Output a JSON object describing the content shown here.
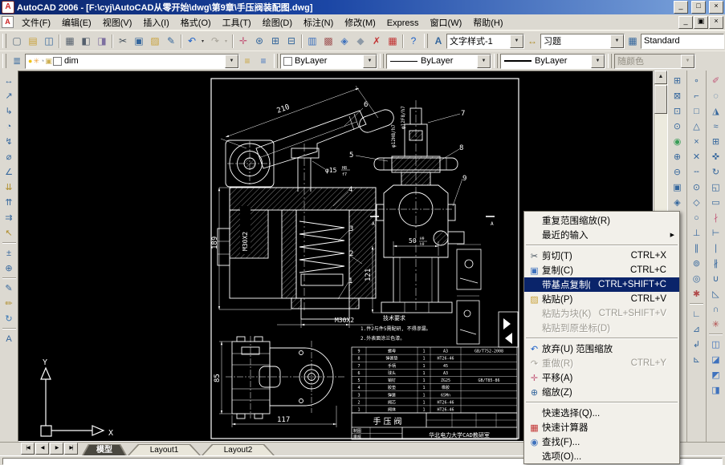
{
  "window": {
    "title": "AutoCAD 2006 - [F:\\cyj\\AutoCAD从零开始\\dwg\\第9章\\手压阀装配图.dwg]",
    "app_icon_letter": "A",
    "buttons": {
      "minimize": "_",
      "maximize": "□",
      "close": "×"
    },
    "child_buttons": {
      "minimize": "_",
      "restore": "▣",
      "close": "×"
    }
  },
  "menu_bar": {
    "items": [
      "文件(F)",
      "编辑(E)",
      "视图(V)",
      "插入(I)",
      "格式(O)",
      "工具(T)",
      "绘图(D)",
      "标注(N)",
      "修改(M)",
      "Express",
      "窗口(W)",
      "帮助(H)"
    ]
  },
  "standard_toolbar": {
    "buttons": [
      {
        "name": "new-button",
        "glyph": "▢",
        "color": "#556a7d"
      },
      {
        "name": "open-button",
        "glyph": "▤",
        "color": "#c9a23a"
      },
      {
        "name": "save-button",
        "glyph": "◫",
        "color": "#35679d"
      },
      {
        "sep": true
      },
      {
        "name": "plot-button",
        "glyph": "▦",
        "color": "#55606d"
      },
      {
        "name": "plot-preview-button",
        "glyph": "◧",
        "color": "#55606d"
      },
      {
        "name": "publish-button",
        "glyph": "◨",
        "color": "#7d6fa0"
      },
      {
        "sep": true
      },
      {
        "name": "cut-button",
        "glyph": "✂",
        "color": "#44505c"
      },
      {
        "name": "copy-button",
        "glyph": "▣",
        "color": "#35679d"
      },
      {
        "name": "paste-button",
        "glyph": "▨",
        "color": "#c9a23a"
      },
      {
        "name": "match-properties-button",
        "glyph": "✎",
        "color": "#35679d"
      },
      {
        "sep": true
      },
      {
        "name": "undo-button",
        "glyph": "↶",
        "color": "#1a5fc8",
        "caret": true
      },
      {
        "name": "redo-button",
        "glyph": "↷",
        "color": "#a8a49a",
        "caret": true,
        "disabled": true
      },
      {
        "sep": true
      },
      {
        "name": "pan-realtime-button",
        "glyph": "✛",
        "color": "#c25a7a"
      },
      {
        "name": "zoom-realtime-button",
        "glyph": "⊛",
        "color": "#35679d"
      },
      {
        "name": "zoom-window-button",
        "glyph": "⊞",
        "color": "#35679d"
      },
      {
        "name": "zoom-previous-button",
        "glyph": "⊟",
        "color": "#35679d"
      },
      {
        "sep": true
      },
      {
        "name": "sheet-set-manager-button",
        "glyph": "▥",
        "color": "#3f72bd"
      },
      {
        "name": "markup-set-manager-button",
        "glyph": "▩",
        "color": "#a05555"
      },
      {
        "name": "hyperlink-button",
        "glyph": "◈",
        "color": "#3f72bd"
      },
      {
        "name": "etransmit-button",
        "glyph": "◆",
        "color": "#8d99a6"
      },
      {
        "name": "tray-cancel-button",
        "glyph": "✗",
        "color": "#c23333"
      },
      {
        "name": "quick-calc-button",
        "glyph": "▦",
        "color": "#c23333"
      },
      {
        "sep": true
      },
      {
        "name": "help-button",
        "glyph": "?",
        "color": "#1a5fc8"
      }
    ]
  },
  "styles_toolbar": {
    "text_style_value": "文字样式-1",
    "dim_style_value": "习题",
    "table_style_value": "Standard",
    "dropdown_glyph": "▼"
  },
  "layers_toolbar": {
    "layer_name": "dim",
    "mini_icons": [
      {
        "name": "bulb-icon",
        "glyph": "●",
        "color": "#f0c418"
      },
      {
        "name": "sun-icon",
        "glyph": "✳",
        "color": "#eda23c"
      },
      {
        "name": "plot-state-icon",
        "glyph": "◔",
        "color": "#9aa4ae"
      },
      {
        "name": "lock-icon",
        "glyph": "▣",
        "color": "#cdb054"
      }
    ]
  },
  "properties_toolbar": {
    "color_value": "ByLayer",
    "linetype_value": "ByLayer",
    "lineweight_value": "ByLayer",
    "plot_style_value": "随颜色"
  },
  "dim_toolbar": {
    "buttons": [
      {
        "name": "dim-linear-button",
        "glyph": "↔",
        "color": "#35679d"
      },
      {
        "name": "dim-aligned-button",
        "glyph": "↗",
        "color": "#35679d"
      },
      {
        "name": "dim-ordinate-button",
        "glyph": "↳",
        "color": "#35679d"
      },
      {
        "name": "dim-radius-button",
        "glyph": "◔",
        "color": "#35679d"
      },
      {
        "name": "dim-jogged-button",
        "glyph": "↯",
        "color": "#35679d"
      },
      {
        "name": "dim-diameter-button",
        "glyph": "⌀",
        "color": "#35679d"
      },
      {
        "name": "dim-angular-button",
        "glyph": "∠",
        "color": "#35679d"
      },
      {
        "name": "quick-dimension-button",
        "glyph": "⇊",
        "color": "#b08f2e"
      },
      {
        "name": "dim-baseline-button",
        "glyph": "⇈",
        "color": "#35679d"
      },
      {
        "name": "dim-continue-button",
        "glyph": "⇉",
        "color": "#35679d"
      },
      {
        "name": "quick-leader-button",
        "glyph": "↖",
        "color": "#b08f2e"
      },
      {
        "sep": true
      },
      {
        "name": "tolerance-button",
        "glyph": "±",
        "color": "#35679d"
      },
      {
        "name": "center-mark-button",
        "glyph": "⊕",
        "color": "#35679d"
      },
      {
        "sep": true
      },
      {
        "name": "dim-edit-button",
        "glyph": "✎",
        "color": "#35679d"
      },
      {
        "name": "dim-text-edit-button",
        "glyph": "✏",
        "color": "#b08f2e"
      },
      {
        "name": "dim-update-button",
        "glyph": "↻",
        "color": "#3a78b5"
      },
      {
        "sep": true
      },
      {
        "name": "dim-style-button",
        "glyph": "A",
        "color": "#35679d"
      }
    ]
  },
  "zoom_toolbar": {
    "buttons": [
      {
        "name": "zoom-window-tool",
        "glyph": "⊞",
        "color": "#35679d"
      },
      {
        "name": "zoom-dynamic-tool",
        "glyph": "⊠",
        "color": "#35679d"
      },
      {
        "name": "zoom-scale-tool",
        "glyph": "⊡",
        "color": "#35679d"
      },
      {
        "name": "zoom-center-tool",
        "glyph": "⊙",
        "color": "#35679d"
      },
      {
        "name": "zoom-object-tool",
        "glyph": "◉",
        "color": "#3a9d58"
      },
      {
        "name": "zoom-in-tool",
        "glyph": "⊕",
        "color": "#35679d"
      },
      {
        "name": "zoom-out-tool",
        "glyph": "⊖",
        "color": "#35679d"
      },
      {
        "name": "zoom-all-tool",
        "glyph": "▣",
        "color": "#35679d"
      },
      {
        "name": "zoom-extents-tool",
        "glyph": "◈",
        "color": "#35679d"
      }
    ]
  },
  "osnap_toolbar": {
    "buttons": [
      {
        "name": "temp-track-point",
        "glyph": "∘",
        "color": "#35679d"
      },
      {
        "name": "snap-from",
        "glyph": "⌐",
        "color": "#35679d"
      },
      {
        "name": "snap-endpoint",
        "glyph": "□",
        "color": "#35679d"
      },
      {
        "name": "snap-midpoint",
        "glyph": "△",
        "color": "#35679d"
      },
      {
        "name": "snap-intersection",
        "glyph": "×",
        "color": "#35679d"
      },
      {
        "name": "snap-apparent-intersection",
        "glyph": "✕",
        "color": "#35679d"
      },
      {
        "name": "snap-extension",
        "glyph": "╌",
        "color": "#35679d"
      },
      {
        "name": "snap-center",
        "glyph": "⊙",
        "color": "#35679d"
      },
      {
        "name": "snap-quadrant",
        "glyph": "◇",
        "color": "#35679d"
      },
      {
        "name": "snap-tangent",
        "glyph": "○",
        "color": "#35679d"
      },
      {
        "name": "snap-perpendicular",
        "glyph": "⊥",
        "color": "#35679d"
      },
      {
        "name": "snap-parallel",
        "glyph": "∥",
        "color": "#35679d"
      },
      {
        "name": "snap-node",
        "glyph": "⊚",
        "color": "#35679d"
      },
      {
        "name": "snap-nearest",
        "glyph": "◎",
        "color": "#35679d"
      },
      {
        "name": "osnap-settings",
        "glyph": "✱",
        "color": "#b04a4a"
      },
      {
        "sep": true
      },
      {
        "name": "ucs-tool",
        "glyph": "∟",
        "color": "#35679d"
      },
      {
        "name": "ucs-world-tool",
        "glyph": "⊿",
        "color": "#35679d"
      },
      {
        "name": "ucs-previous-tool",
        "glyph": "↲",
        "color": "#35679d"
      },
      {
        "name": "ucs-object-tool",
        "glyph": "⊾",
        "color": "#35679d"
      }
    ]
  },
  "modify_toolbar": {
    "buttons": [
      {
        "name": "erase-tool",
        "glyph": "✐",
        "color": "#c25a7a"
      },
      {
        "name": "copy-tool",
        "glyph": "◌",
        "color": "#35679d"
      },
      {
        "name": "mirror-tool",
        "glyph": "◮",
        "color": "#35679d"
      },
      {
        "name": "offset-tool",
        "glyph": "≈",
        "color": "#35679d"
      },
      {
        "name": "array-tool",
        "glyph": "⊞",
        "color": "#35679d"
      },
      {
        "name": "move-tool",
        "glyph": "✜",
        "color": "#35679d"
      },
      {
        "name": "rotate-tool",
        "glyph": "↻",
        "color": "#35679d"
      },
      {
        "name": "scale-tool",
        "glyph": "◱",
        "color": "#35679d"
      },
      {
        "name": "stretch-tool",
        "glyph": "▭",
        "color": "#35679d"
      },
      {
        "name": "trim-tool",
        "glyph": "∤",
        "color": "#c25a7a"
      },
      {
        "name": "extend-tool",
        "glyph": "⊢",
        "color": "#35679d"
      },
      {
        "name": "break-at-point-tool",
        "glyph": "∣",
        "color": "#35679d"
      },
      {
        "name": "break-tool",
        "glyph": "∦",
        "color": "#35679d"
      },
      {
        "name": "join-tool",
        "glyph": "∪",
        "color": "#35679d"
      },
      {
        "name": "chamfer-tool",
        "glyph": "◺",
        "color": "#35679d"
      },
      {
        "name": "fillet-tool",
        "glyph": "∩",
        "color": "#35679d"
      },
      {
        "name": "explode-tool",
        "glyph": "✳",
        "color": "#b04a4a"
      },
      {
        "sep": true
      },
      {
        "name": "draworder-front-tool",
        "glyph": "◫",
        "color": "#3f72bd"
      },
      {
        "name": "draworder-back-tool",
        "glyph": "◪",
        "color": "#3f72bd"
      },
      {
        "name": "draworder-above-tool",
        "glyph": "◩",
        "color": "#3f72bd"
      },
      {
        "name": "draworder-under-tool",
        "glyph": "◨",
        "color": "#3f72bd"
      }
    ]
  },
  "scrollbar": {
    "up_glyph": "▲",
    "down_glyph": "▼"
  },
  "tabs": {
    "nav": [
      "|◀",
      "◀",
      "▶",
      "▶|"
    ],
    "items": [
      "模型",
      "Layout1",
      "Layout2"
    ],
    "active_index": 0
  },
  "context_menu": {
    "items": [
      {
        "name": "repeat-zoom-extents",
        "label": "重复范围缩放(R)"
      },
      {
        "name": "recent-input",
        "label": "最近的输入",
        "submenu": true
      },
      {
        "sep": true
      },
      {
        "name": "cut",
        "label": "剪切(T)",
        "shortcut": "CTRL+X",
        "icon": "✂",
        "icon_color": "#44505c"
      },
      {
        "name": "copy",
        "label": "复制(C)",
        "shortcut": "CTRL+C",
        "icon": "▣",
        "icon_color": "#3f72bd"
      },
      {
        "name": "copy-with-base-point",
        "label": "带基点复制(B)",
        "shortcut": "CTRL+SHIFT+C",
        "highlight": true
      },
      {
        "name": "paste",
        "label": "粘贴(P)",
        "shortcut": "CTRL+V",
        "icon": "▨",
        "icon_color": "#c9a23a"
      },
      {
        "name": "paste-as-block",
        "label": "粘贴为块(K)",
        "shortcut": "CTRL+SHIFT+V",
        "disabled": true
      },
      {
        "name": "paste-to-original-coords",
        "label": "粘贴到原坐标(D)",
        "disabled": true
      },
      {
        "sep": true
      },
      {
        "name": "undo-zoom",
        "label": "放弃(U) 范围缩放",
        "icon": "↶",
        "icon_color": "#1a5fc8"
      },
      {
        "name": "redo",
        "label": "重做(R)",
        "shortcut": "CTRL+Y",
        "icon": "↷",
        "icon_color": "#a8a49a",
        "disabled": true
      },
      {
        "name": "pan",
        "label": "平移(A)",
        "icon": "✛",
        "icon_color": "#c25a7a"
      },
      {
        "name": "zoom",
        "label": "缩放(Z)",
        "icon": "⊕",
        "icon_color": "#35679d"
      },
      {
        "sep": true
      },
      {
        "name": "quick-select",
        "label": "快速选择(Q)..."
      },
      {
        "name": "quick-calc",
        "label": "快速计算器",
        "icon": "▦",
        "icon_color": "#c23333"
      },
      {
        "name": "find",
        "label": "查找(F)...",
        "icon": "◉",
        "icon_color": "#3f72bd"
      },
      {
        "name": "options",
        "label": "选项(O)..."
      }
    ]
  },
  "drawing": {
    "dim_210": "210",
    "dim_189": "189",
    "dim_121": "121",
    "dim_117": "117",
    "dim_85": "85",
    "dim_m30_side": "M30X2",
    "dim_m30_bottom": "M30X2",
    "dim_phi15": "φ15",
    "dim_phi15_up": "H8",
    "dim_phi15_dn": "f7",
    "dim_phi12_left": "φ12H8/h7",
    "dim_phi12_right": "φ12F8/h7",
    "dim_50": "50",
    "dim_50_up": "H9",
    "dim_50_dn": "h9",
    "label_1": "1",
    "label_2": "2",
    "label_3": "3",
    "label_4": "4",
    "label_5": "5",
    "label_6": "6",
    "label_7": "7",
    "label_8": "8",
    "label_9": "9",
    "section_a_left": "A",
    "section_a_right": "A",
    "tech_title": "技术要求",
    "tech_line1": "1.件2与件5需配研, 不得渗漏。",
    "tech_line2": "2.外表面涂兰色漆。",
    "ucs_x": "X",
    "ucs_y": "Y",
    "title_block": {
      "part_name": "手压阀",
      "org": "华北电力大学CAD教研室",
      "cell_draw": "制图",
      "cell_check": "审核"
    },
    "bom_rows": [
      [
        "9",
        "螺母",
        "1",
        "A3",
        "GB/T752-2008"
      ],
      [
        "8",
        "弹簧垫",
        "1",
        "HT26-46",
        ""
      ],
      [
        "7",
        "手柄",
        "1",
        "45",
        ""
      ],
      [
        "6",
        "球头",
        "1",
        "A3",
        ""
      ],
      [
        "5",
        "销钉",
        "1",
        "ZG25",
        "GB/T85-86"
      ],
      [
        "4",
        "胶垫",
        "1",
        "橡胶",
        ""
      ],
      [
        "3",
        "弹簧",
        "1",
        "65Mn",
        ""
      ],
      [
        "2",
        "阀芯",
        "1",
        "HT26-46",
        ""
      ],
      [
        "1",
        "阀体",
        "1",
        "HT26-46",
        ""
      ]
    ]
  }
}
